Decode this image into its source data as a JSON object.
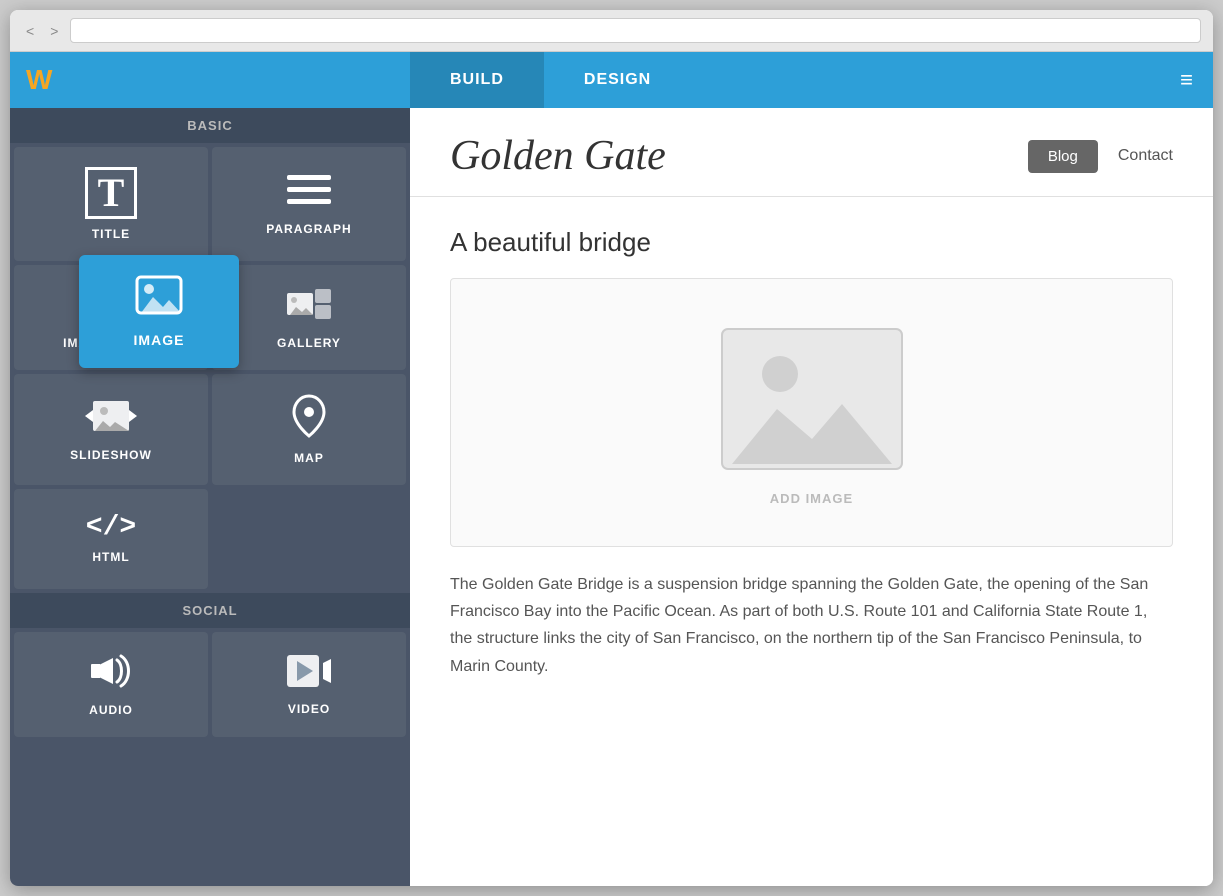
{
  "browser": {
    "back_btn": "<",
    "forward_btn": ">"
  },
  "topnav": {
    "brand": "W",
    "tabs": [
      {
        "id": "build",
        "label": "BUILD",
        "active": true
      },
      {
        "id": "design",
        "label": "DESIGN",
        "active": false
      }
    ],
    "menu_icon": "≡"
  },
  "sidebar": {
    "sections": [
      {
        "id": "basic",
        "label": "BASIC",
        "items": [
          {
            "id": "title",
            "label": "TITLE",
            "icon": "T"
          },
          {
            "id": "paragraph",
            "label": "PARAGRAPH",
            "icon": "≡"
          },
          {
            "id": "image-text",
            "label": "IMAGE + TEXT",
            "icon": "🖼",
            "highlighted": false
          },
          {
            "id": "gallery",
            "label": "GALLERY",
            "icon": "🗂"
          },
          {
            "id": "slideshow",
            "label": "SLIDESHOW",
            "icon": "◀🖼▶"
          },
          {
            "id": "map",
            "label": "MAP",
            "icon": "📍"
          },
          {
            "id": "html",
            "label": "HTML",
            "icon": "</>"
          }
        ]
      },
      {
        "id": "social",
        "label": "SOCIAL",
        "items": [
          {
            "id": "audio",
            "label": "AUDIO",
            "icon": "🔊"
          },
          {
            "id": "video",
            "label": "VIDEO",
            "icon": "▶"
          }
        ]
      }
    ]
  },
  "tooltip": {
    "label": "IMAGE"
  },
  "page": {
    "site_title": "Golden Gate",
    "nav_items": [
      {
        "id": "blog",
        "label": "Blog",
        "active": true
      },
      {
        "id": "contact",
        "label": "Contact",
        "active": false
      }
    ],
    "section_title": "A beautiful bridge",
    "add_image_label": "ADD IMAGE",
    "body_text": "The Golden Gate Bridge is a suspension bridge spanning the Golden Gate, the opening of the San Francisco Bay into the Pacific Ocean. As part of both U.S. Route 101 and California State Route 1, the structure links the city of San Francisco, on the northern tip of the San Francisco Peninsula, to Marin County."
  }
}
